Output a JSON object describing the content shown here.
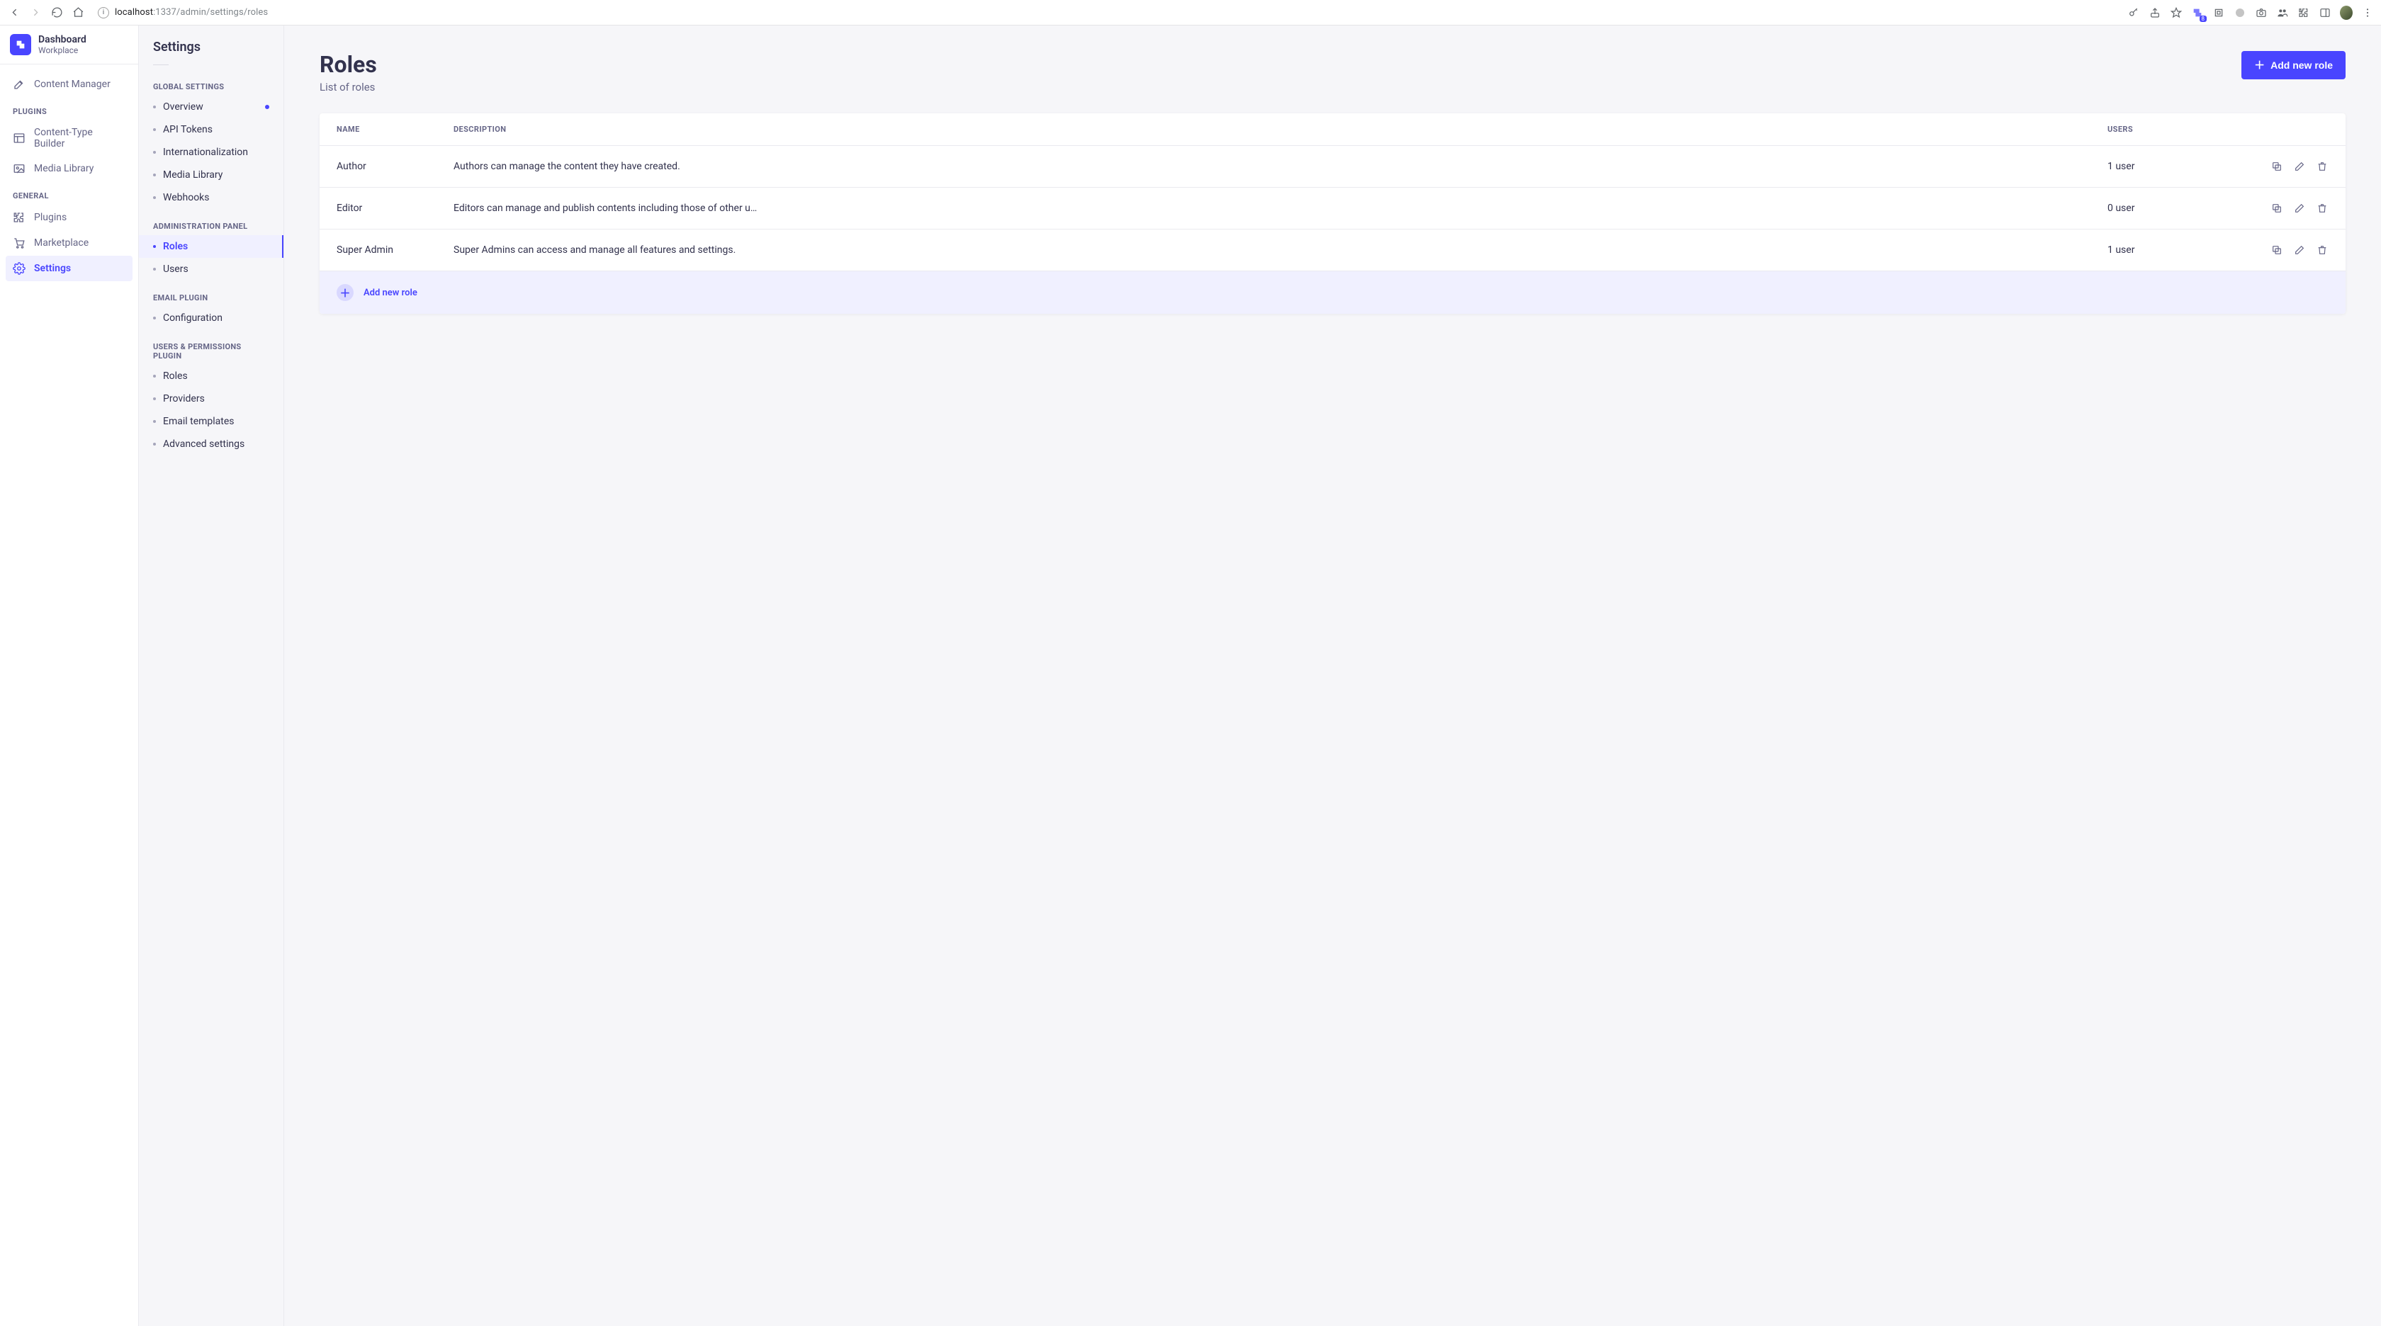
{
  "browser": {
    "url_host": "localhost",
    "url_port_path": ":1337/admin/settings/roles"
  },
  "brand": {
    "title": "Dashboard",
    "subtitle": "Workplace"
  },
  "nav": {
    "content_manager": "Content Manager",
    "section_plugins": "PLUGINS",
    "content_type_builder": "Content-Type Builder",
    "media_library": "Media Library",
    "section_general": "GENERAL",
    "plugins": "Plugins",
    "marketplace": "Marketplace",
    "settings": "Settings"
  },
  "settings_panel": {
    "title": "Settings",
    "groups": {
      "global": {
        "label": "GLOBAL SETTINGS",
        "items": {
          "overview": "Overview",
          "api_tokens": "API Tokens",
          "internationalization": "Internationalization",
          "media_library": "Media Library",
          "webhooks": "Webhooks"
        }
      },
      "admin": {
        "label": "ADMINISTRATION PANEL",
        "items": {
          "roles": "Roles",
          "users": "Users"
        }
      },
      "email": {
        "label": "EMAIL PLUGIN",
        "items": {
          "configuration": "Configuration"
        }
      },
      "users_perms": {
        "label": "USERS & PERMISSIONS PLUGIN",
        "items": {
          "roles": "Roles",
          "providers": "Providers",
          "email_templates": "Email templates",
          "advanced_settings": "Advanced settings"
        }
      }
    }
  },
  "page": {
    "title": "Roles",
    "subtitle": "List of roles",
    "add_button": "Add new role",
    "table": {
      "headers": {
        "name": "NAME",
        "description": "DESCRIPTION",
        "users": "USERS"
      },
      "rows": [
        {
          "name": "Author",
          "description": "Authors can manage the content they have created.",
          "users": "1 user"
        },
        {
          "name": "Editor",
          "description": "Editors can manage and publish contents including those of other u…",
          "users": "0 user"
        },
        {
          "name": "Super Admin",
          "description": "Super Admins can access and manage all features and settings.",
          "users": "1 user"
        }
      ],
      "footer_label": "Add new role"
    }
  }
}
